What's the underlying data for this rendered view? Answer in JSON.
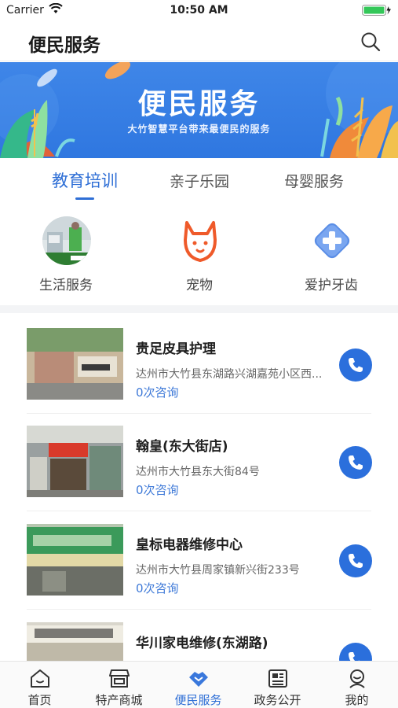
{
  "status_bar": {
    "carrier": "Carrier",
    "time": "10:50 AM"
  },
  "header": {
    "title": "便民服务"
  },
  "banner": {
    "title": "便民服务",
    "subtitle": "大竹智慧平台带来最便民的服务"
  },
  "tabs": [
    {
      "label": "教育培训",
      "active": true
    },
    {
      "label": "亲子乐园",
      "active": false
    },
    {
      "label": "母婴服务",
      "active": false
    }
  ],
  "categories": [
    {
      "label": "生活服务",
      "icon": "appliance-repair-photo"
    },
    {
      "label": "宠物",
      "icon": "pet-icon"
    },
    {
      "label": "爱护牙齿",
      "icon": "tooth-care-icon"
    }
  ],
  "listings": [
    {
      "name": "贵足皮具护理",
      "address": "达州市大竹县东湖路兴湖嘉苑小区西...",
      "consult": "0次咨询"
    },
    {
      "name": "翰皇(东大街店)",
      "address": "达州市大竹县东大街84号",
      "consult": "0次咨询"
    },
    {
      "name": "皇标电器维修中心",
      "address": "达州市大竹县周家镇新兴街233号",
      "consult": "0次咨询"
    },
    {
      "name": "华川家电维修(东湖路)",
      "address": "",
      "consult": ""
    }
  ],
  "tab_bar": [
    {
      "label": "首页",
      "icon": "home-icon",
      "active": false
    },
    {
      "label": "特产商城",
      "icon": "shop-icon",
      "active": false
    },
    {
      "label": "便民服务",
      "icon": "handshake-icon",
      "active": true
    },
    {
      "label": "政务公开",
      "icon": "news-icon",
      "active": false
    },
    {
      "label": "我的",
      "icon": "profile-icon",
      "active": false
    }
  ],
  "colors": {
    "accent": "#2f6fd6",
    "call_button": "#2b6fdc",
    "banner": "#3f86e8"
  }
}
